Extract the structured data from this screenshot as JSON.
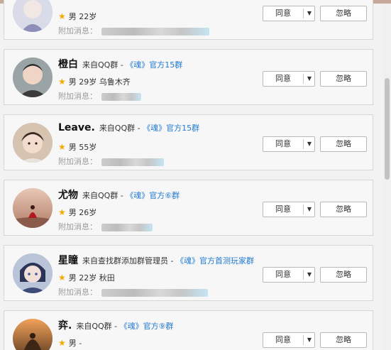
{
  "requests": [
    {
      "name": "",
      "source": "",
      "group": "",
      "gender": "男",
      "age": "22岁",
      "location": "",
      "extra_label": "附加消息：",
      "agree": "同意",
      "ignore": "忽略"
    },
    {
      "name": "橙白",
      "source": "来自QQ群 - ",
      "group": "《魂》官方15群",
      "gender": "男",
      "age": "29岁",
      "location": "乌鲁木齐",
      "extra_label": "附加消息：",
      "agree": "同意",
      "ignore": "忽略"
    },
    {
      "name": "Leave.",
      "source": "来自QQ群 - ",
      "group": "《魂》官方15群",
      "gender": "男",
      "age": "55岁",
      "location": "",
      "extra_label": "附加消息：",
      "agree": "同意",
      "ignore": "忽略"
    },
    {
      "name": "尤物",
      "source": "来自QQ群 - ",
      "group": "《魂》官方⑥群",
      "gender": "男",
      "age": "26岁",
      "location": "",
      "extra_label": "附加消息：",
      "agree": "同意",
      "ignore": "忽略"
    },
    {
      "name": "星瞳",
      "source": "来自查找群添加群管理员 - ",
      "group": "《魂》官方首测玩家群",
      "gender": "男",
      "age": "22岁",
      "location": "秋田",
      "extra_label": "附加消息：",
      "agree": "同意",
      "ignore": "忽略"
    },
    {
      "name": "弈.",
      "source": "来自QQ群 - ",
      "group": "《魂》官方⑨群",
      "gender": "男",
      "age": "-",
      "location": "",
      "extra_label": "",
      "agree": "同意",
      "ignore": "忽略"
    }
  ]
}
